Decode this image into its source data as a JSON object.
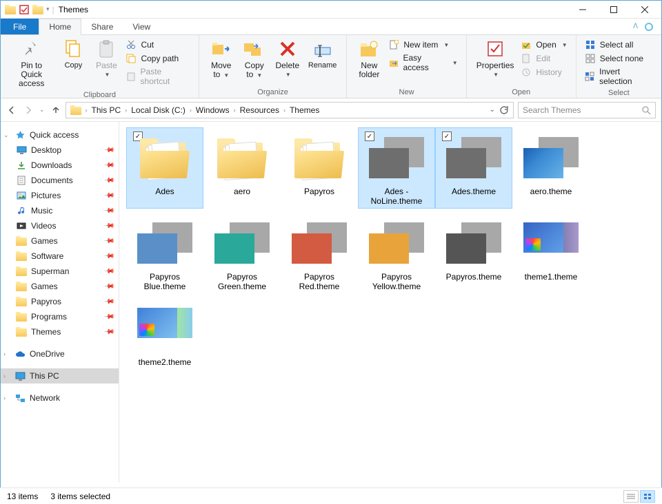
{
  "window": {
    "title": "Themes"
  },
  "tabs": {
    "file": "File",
    "home": "Home",
    "share": "Share",
    "view": "View"
  },
  "ribbon": {
    "clipboard": {
      "label": "Clipboard",
      "pin": {
        "l1": "Pin to Quick",
        "l2": "access"
      },
      "copy": "Copy",
      "paste": "Paste",
      "cut": "Cut",
      "copypath": "Copy path",
      "pasteshort": "Paste shortcut"
    },
    "organize": {
      "label": "Organize",
      "moveto": {
        "l1": "Move",
        "l2": "to"
      },
      "copyto": {
        "l1": "Copy",
        "l2": "to"
      },
      "delete": "Delete",
      "rename": "Rename"
    },
    "new": {
      "label": "New",
      "newfolder": {
        "l1": "New",
        "l2": "folder"
      },
      "newitem": "New item",
      "easyaccess": "Easy access"
    },
    "open": {
      "label": "Open",
      "properties": "Properties",
      "open": "Open",
      "edit": "Edit",
      "history": "History"
    },
    "select": {
      "label": "Select",
      "all": "Select all",
      "none": "Select none",
      "invert": "Invert selection"
    }
  },
  "breadcrumbs": [
    "This PC",
    "Local Disk (C:)",
    "Windows",
    "Resources",
    "Themes"
  ],
  "search": {
    "placeholder": "Search Themes"
  },
  "sidebar": {
    "quick": "Quick access",
    "items": [
      {
        "label": "Desktop",
        "icon": "desktop"
      },
      {
        "label": "Downloads",
        "icon": "down"
      },
      {
        "label": "Documents",
        "icon": "doc"
      },
      {
        "label": "Pictures",
        "icon": "pic"
      },
      {
        "label": "Music",
        "icon": "music"
      },
      {
        "label": "Videos",
        "icon": "video"
      },
      {
        "label": "Games",
        "icon": "folder"
      },
      {
        "label": "Software",
        "icon": "folder"
      },
      {
        "label": "Superman",
        "icon": "folder"
      },
      {
        "label": "Games",
        "icon": "folder"
      },
      {
        "label": "Papyros",
        "icon": "folder"
      },
      {
        "label": "Programs",
        "icon": "folder"
      },
      {
        "label": "Themes",
        "icon": "folder"
      }
    ],
    "onedrive": "OneDrive",
    "thispc": "This PC",
    "network": "Network"
  },
  "items": [
    {
      "name": "Ades",
      "type": "folder",
      "selected": true
    },
    {
      "name": "aero",
      "type": "folder",
      "selected": false
    },
    {
      "name": "Papyros",
      "type": "folder",
      "selected": false
    },
    {
      "name": "Ades - NoLine.theme",
      "type": "theme",
      "color": "gray",
      "selected": true
    },
    {
      "name": "Ades.theme",
      "type": "theme",
      "color": "gray",
      "selected": true
    },
    {
      "name": "aero.theme",
      "type": "theme",
      "color": "aero",
      "selected": false
    },
    {
      "name": "Papyros Blue.theme",
      "type": "theme",
      "color": "blue",
      "selected": false
    },
    {
      "name": "Papyros Green.theme",
      "type": "theme",
      "color": "green",
      "selected": false
    },
    {
      "name": "Papyros Red.theme",
      "type": "theme",
      "color": "red",
      "selected": false
    },
    {
      "name": "Papyros Yellow.theme",
      "type": "theme",
      "color": "yellow",
      "selected": false
    },
    {
      "name": "Papyros.theme",
      "type": "theme",
      "color": "dark",
      "selected": false
    },
    {
      "name": "theme1.theme",
      "type": "theme",
      "color": "collage",
      "selected": false
    },
    {
      "name": "theme2.theme",
      "type": "theme",
      "color": "collage2",
      "selected": false
    }
  ],
  "status": {
    "count": "13 items",
    "selected": "3 items selected"
  }
}
